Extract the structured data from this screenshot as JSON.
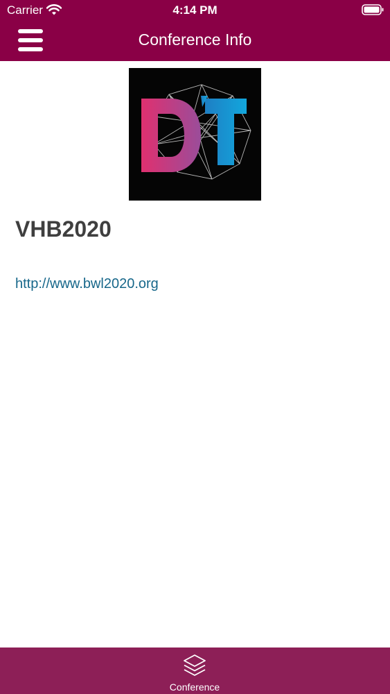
{
  "status_bar": {
    "carrier": "Carrier",
    "time": "4:14 PM"
  },
  "nav": {
    "title": "Conference Info",
    "menu_icon": "hamburger-menu-icon"
  },
  "conference": {
    "logo_text": "DT",
    "name": "VHB2020",
    "url": "http://www.bwl2020.org"
  },
  "tab_bar": {
    "items": [
      {
        "label": "Conference",
        "icon": "layers-icon"
      }
    ]
  },
  "colors": {
    "header": "#8a0046",
    "tab_bar": "#8d1f57",
    "title_text": "#3f3f3f",
    "link": "#17678a"
  }
}
